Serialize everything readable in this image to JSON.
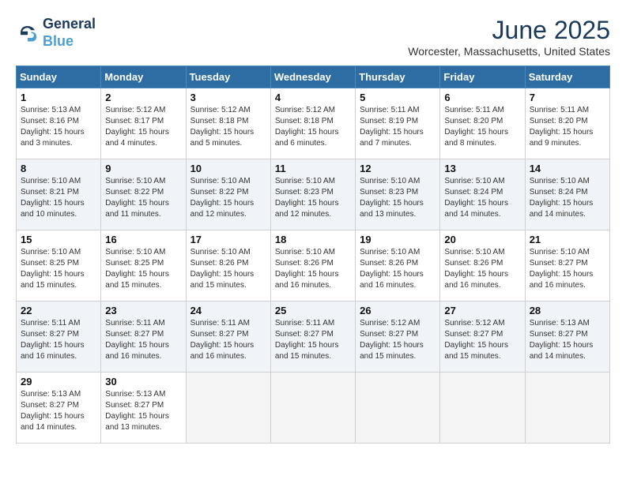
{
  "header": {
    "logo_line1": "General",
    "logo_line2": "Blue",
    "month_title": "June 2025",
    "location": "Worcester, Massachusetts, United States"
  },
  "weekdays": [
    "Sunday",
    "Monday",
    "Tuesday",
    "Wednesday",
    "Thursday",
    "Friday",
    "Saturday"
  ],
  "weeks": [
    [
      {
        "day": "1",
        "sunrise": "5:13 AM",
        "sunset": "8:16 PM",
        "daylight": "15 hours and 3 minutes."
      },
      {
        "day": "2",
        "sunrise": "5:12 AM",
        "sunset": "8:17 PM",
        "daylight": "15 hours and 4 minutes."
      },
      {
        "day": "3",
        "sunrise": "5:12 AM",
        "sunset": "8:18 PM",
        "daylight": "15 hours and 5 minutes."
      },
      {
        "day": "4",
        "sunrise": "5:12 AM",
        "sunset": "8:18 PM",
        "daylight": "15 hours and 6 minutes."
      },
      {
        "day": "5",
        "sunrise": "5:11 AM",
        "sunset": "8:19 PM",
        "daylight": "15 hours and 7 minutes."
      },
      {
        "day": "6",
        "sunrise": "5:11 AM",
        "sunset": "8:20 PM",
        "daylight": "15 hours and 8 minutes."
      },
      {
        "day": "7",
        "sunrise": "5:11 AM",
        "sunset": "8:20 PM",
        "daylight": "15 hours and 9 minutes."
      }
    ],
    [
      {
        "day": "8",
        "sunrise": "5:10 AM",
        "sunset": "8:21 PM",
        "daylight": "15 hours and 10 minutes."
      },
      {
        "day": "9",
        "sunrise": "5:10 AM",
        "sunset": "8:22 PM",
        "daylight": "15 hours and 11 minutes."
      },
      {
        "day": "10",
        "sunrise": "5:10 AM",
        "sunset": "8:22 PM",
        "daylight": "15 hours and 12 minutes."
      },
      {
        "day": "11",
        "sunrise": "5:10 AM",
        "sunset": "8:23 PM",
        "daylight": "15 hours and 12 minutes."
      },
      {
        "day": "12",
        "sunrise": "5:10 AM",
        "sunset": "8:23 PM",
        "daylight": "15 hours and 13 minutes."
      },
      {
        "day": "13",
        "sunrise": "5:10 AM",
        "sunset": "8:24 PM",
        "daylight": "15 hours and 14 minutes."
      },
      {
        "day": "14",
        "sunrise": "5:10 AM",
        "sunset": "8:24 PM",
        "daylight": "15 hours and 14 minutes."
      }
    ],
    [
      {
        "day": "15",
        "sunrise": "5:10 AM",
        "sunset": "8:25 PM",
        "daylight": "15 hours and 15 minutes."
      },
      {
        "day": "16",
        "sunrise": "5:10 AM",
        "sunset": "8:25 PM",
        "daylight": "15 hours and 15 minutes."
      },
      {
        "day": "17",
        "sunrise": "5:10 AM",
        "sunset": "8:26 PM",
        "daylight": "15 hours and 15 minutes."
      },
      {
        "day": "18",
        "sunrise": "5:10 AM",
        "sunset": "8:26 PM",
        "daylight": "15 hours and 16 minutes."
      },
      {
        "day": "19",
        "sunrise": "5:10 AM",
        "sunset": "8:26 PM",
        "daylight": "15 hours and 16 minutes."
      },
      {
        "day": "20",
        "sunrise": "5:10 AM",
        "sunset": "8:26 PM",
        "daylight": "15 hours and 16 minutes."
      },
      {
        "day": "21",
        "sunrise": "5:10 AM",
        "sunset": "8:27 PM",
        "daylight": "15 hours and 16 minutes."
      }
    ],
    [
      {
        "day": "22",
        "sunrise": "5:11 AM",
        "sunset": "8:27 PM",
        "daylight": "15 hours and 16 minutes."
      },
      {
        "day": "23",
        "sunrise": "5:11 AM",
        "sunset": "8:27 PM",
        "daylight": "15 hours and 16 minutes."
      },
      {
        "day": "24",
        "sunrise": "5:11 AM",
        "sunset": "8:27 PM",
        "daylight": "15 hours and 16 minutes."
      },
      {
        "day": "25",
        "sunrise": "5:11 AM",
        "sunset": "8:27 PM",
        "daylight": "15 hours and 15 minutes."
      },
      {
        "day": "26",
        "sunrise": "5:12 AM",
        "sunset": "8:27 PM",
        "daylight": "15 hours and 15 minutes."
      },
      {
        "day": "27",
        "sunrise": "5:12 AM",
        "sunset": "8:27 PM",
        "daylight": "15 hours and 15 minutes."
      },
      {
        "day": "28",
        "sunrise": "5:13 AM",
        "sunset": "8:27 PM",
        "daylight": "15 hours and 14 minutes."
      }
    ],
    [
      {
        "day": "29",
        "sunrise": "5:13 AM",
        "sunset": "8:27 PM",
        "daylight": "15 hours and 14 minutes."
      },
      {
        "day": "30",
        "sunrise": "5:13 AM",
        "sunset": "8:27 PM",
        "daylight": "15 hours and 13 minutes."
      },
      null,
      null,
      null,
      null,
      null
    ]
  ]
}
